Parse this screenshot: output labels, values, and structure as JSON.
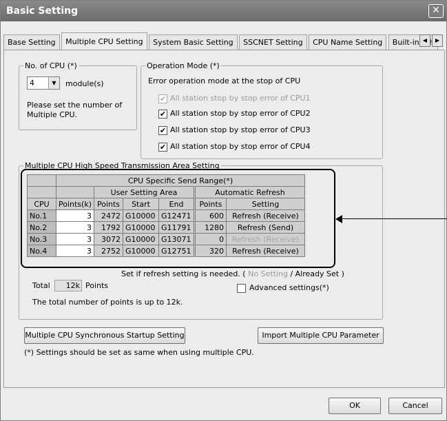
{
  "window": {
    "title": "Basic Setting",
    "close_glyph": "✕"
  },
  "tabs": [
    {
      "label": "Base Setting"
    },
    {
      "label": "Multiple CPU Setting",
      "active": true
    },
    {
      "label": "System Basic Setting"
    },
    {
      "label": "SSCNET Setting"
    },
    {
      "label": "CPU Name Setting"
    },
    {
      "label": "Built-in Eth"
    }
  ],
  "tab_scroll": {
    "left": "◀",
    "right": "▶"
  },
  "num_cpu": {
    "legend": "No. of CPU (*)",
    "value": "4",
    "unit": "module(s)",
    "hint_line1": "Please set the number of",
    "hint_line2": "Multiple CPU."
  },
  "operation_mode": {
    "legend": "Operation Mode (*)",
    "subtitle": "Error operation mode at the stop of CPU",
    "options": [
      {
        "label": "All station stop by stop error of CPU1",
        "checked": true,
        "disabled": true
      },
      {
        "label": "All station stop by stop error of CPU2",
        "checked": true,
        "disabled": false
      },
      {
        "label": "All station stop by stop error of CPU3",
        "checked": true,
        "disabled": false
      },
      {
        "label": "All station stop by stop error of CPU4",
        "checked": true,
        "disabled": false
      }
    ]
  },
  "transmission": {
    "legend": "Multiple CPU High Speed Transmission Area Setting",
    "headers": {
      "send_range": "CPU Specific Send Range(*)",
      "user_area": "User Setting Area",
      "auto_refresh": "Automatic Refresh",
      "cpu": "CPU",
      "points_k": "Points(k)",
      "points": "Points",
      "start": "Start",
      "end": "End",
      "ar_points": "Points",
      "setting": "Setting"
    },
    "rows": [
      {
        "cpu": "No.1",
        "points_k": "3",
        "points": "2472",
        "start": "G10000",
        "end": "G12471",
        "ar_points": "600",
        "setting": "Refresh (Receive)",
        "dim": false
      },
      {
        "cpu": "No.2",
        "points_k": "3",
        "points": "1792",
        "start": "G10000",
        "end": "G11791",
        "ar_points": "1280",
        "setting": "Refresh (Send)",
        "dim": false
      },
      {
        "cpu": "No.3",
        "points_k": "3",
        "points": "3072",
        "start": "G10000",
        "end": "G13071",
        "ar_points": "0",
        "setting": "Refresh (Receive)",
        "dim": true
      },
      {
        "cpu": "No.4",
        "points_k": "3",
        "points": "2752",
        "start": "G10000",
        "end": "G12751",
        "ar_points": "320",
        "setting": "Refresh (Receive)",
        "dim": false
      }
    ],
    "refresh_note_prefix": "Set if refresh setting is needed. (",
    "no_setting": "No Setting",
    "slash": "/",
    "already_set": "Already Set",
    "refresh_note_suffix": ")",
    "total_label": "Total",
    "total_value": "12k",
    "total_unit": "Points",
    "advanced_label": "Advanced settings(*)",
    "limit_note": "The total number of points is up to 12k."
  },
  "buttons": {
    "sync_startup": "Multiple CPU Synchronous Startup Setting",
    "import_param": "Import Multiple CPU Parameter",
    "ok": "OK",
    "cancel": "Cancel"
  },
  "footer_note": "(*) Settings should be set as same when using multiple CPU.",
  "colors": {
    "titlebar": "#7a7a7a",
    "panel": "#ececec",
    "table_cell": "#cfcfcf"
  }
}
